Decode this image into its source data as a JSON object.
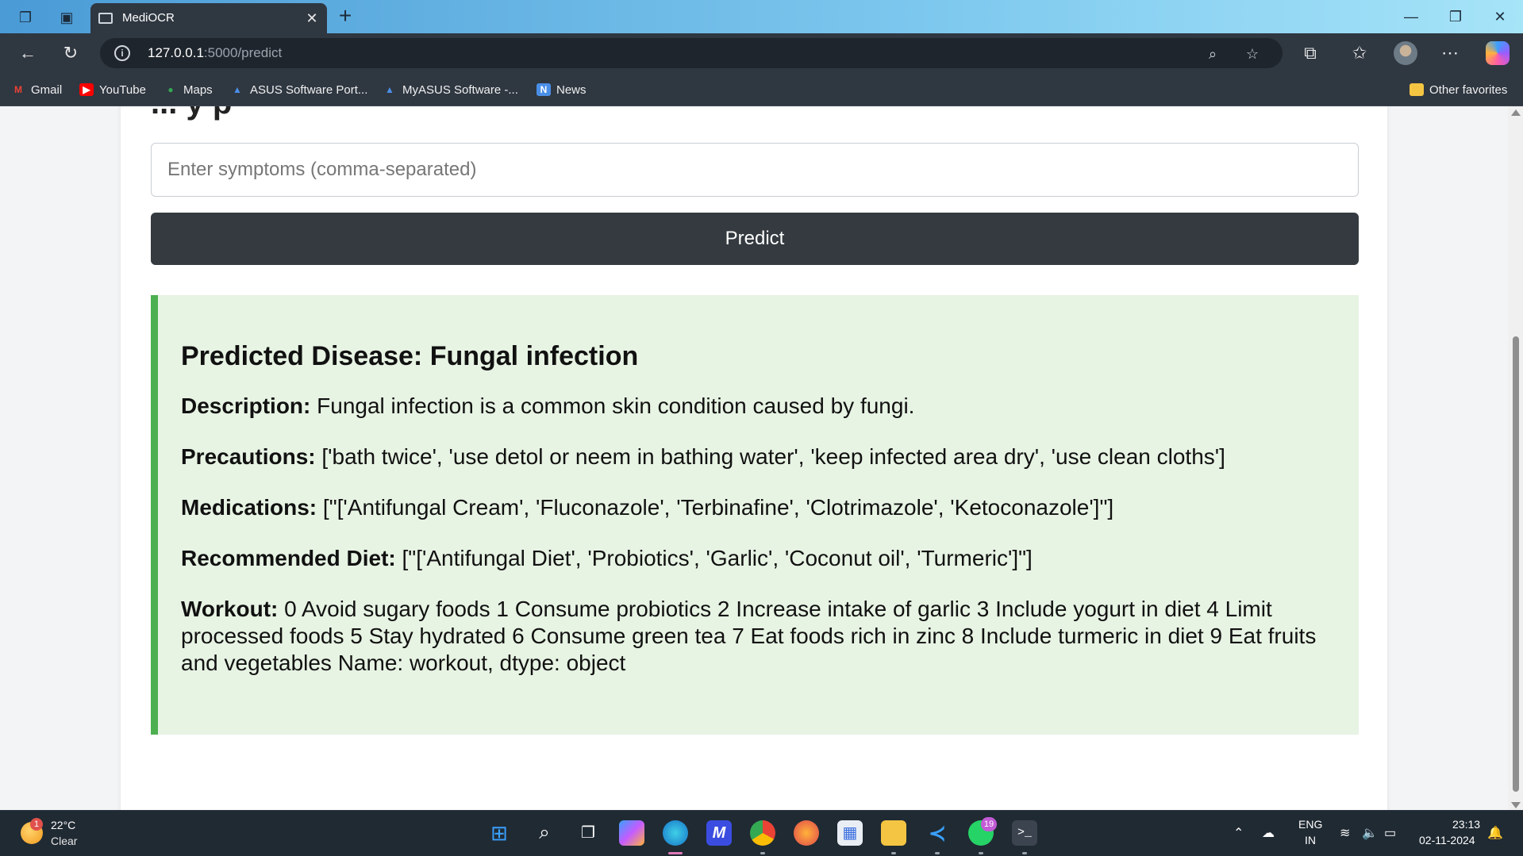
{
  "browser": {
    "tab_title": "MediOCR",
    "url_host": "127.0.0.1",
    "url_path": ":5000/predict",
    "favorites": [
      {
        "label": "Gmail",
        "icon": "gmail-icon"
      },
      {
        "label": "YouTube",
        "icon": "youtube-icon"
      },
      {
        "label": "Maps",
        "icon": "maps-icon"
      },
      {
        "label": "ASUS Software Port...",
        "icon": "asus-icon"
      },
      {
        "label": "MyASUS Software -...",
        "icon": "asus-icon"
      },
      {
        "label": "News",
        "icon": "news-icon"
      }
    ],
    "other_favorites": "Other favorites"
  },
  "page": {
    "heading_partial": "... y p",
    "input_placeholder": "Enter symptoms (comma-separated)",
    "predict_label": "Predict",
    "result": {
      "disease_title": "Predicted Disease: Fungal infection",
      "description_label": "Description:",
      "description_value": " Fungal infection is a common skin condition caused by fungi.",
      "precautions_label": "Precautions:",
      "precautions_value": " ['bath twice', 'use detol or neem in bathing water', 'keep infected area dry', 'use clean cloths']",
      "medications_label": "Medications:",
      "medications_value": " [\"['Antifungal Cream', 'Fluconazole', 'Terbinafine', 'Clotrimazole', 'Ketoconazole']\"]",
      "diet_label": "Recommended Diet:",
      "diet_value": " [\"['Antifungal Diet', 'Probiotics', 'Garlic', 'Coconut oil', 'Turmeric']\"]",
      "workout_label": "Workout:",
      "workout_value": " 0 Avoid sugary foods 1 Consume probiotics 2 Increase intake of garlic 3 Include yogurt in diet 4 Limit processed foods 5 Stay hydrated 6 Consume green tea 7 Eat foods rich in zinc 8 Include turmeric in diet 9 Eat fruits and vegetables Name: workout, dtype: object"
    }
  },
  "taskbar": {
    "weather_badge": "1",
    "weather_temp": "22°C",
    "weather_cond": "Clear",
    "whatsapp_badge": "19",
    "lang_line1": "ENG",
    "lang_line2": "IN",
    "time": "23:13",
    "date": "02-11-2024"
  },
  "colors": {
    "accent_green": "#4caf50",
    "result_bg": "#e7f3e3",
    "button_dark": "#343a40"
  }
}
